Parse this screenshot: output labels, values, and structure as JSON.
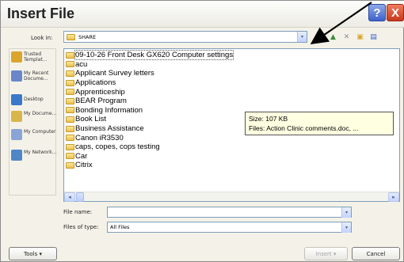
{
  "dialog": {
    "title": "Insert File",
    "help_glyph": "?",
    "close_glyph": "X"
  },
  "look_in": {
    "label": "Look in:",
    "value": "SHARE",
    "dropdown_glyph": "▾"
  },
  "toolbar": [
    {
      "name": "back-icon",
      "glyph": "◀"
    },
    {
      "name": "up-folder-icon",
      "glyph": "▲"
    },
    {
      "name": "delete-icon",
      "glyph": "✕"
    },
    {
      "name": "new-folder-icon",
      "glyph": "▣"
    },
    {
      "name": "views-icon",
      "glyph": "▤"
    }
  ],
  "places": [
    {
      "name": "trusted-templates",
      "label": "Trusted Templat...",
      "color": "#d9a52c"
    },
    {
      "name": "my-recent-documents",
      "label": "My Recent Docume...",
      "color": "#6a86c9"
    },
    {
      "name": "desktop",
      "label": "Desktop",
      "color": "#3a79c9"
    },
    {
      "name": "my-documents",
      "label": "My Docume...",
      "color": "#d8b64b"
    },
    {
      "name": "my-computer",
      "label": "My Computer",
      "color": "#8aa4d6"
    },
    {
      "name": "my-network",
      "label": "My Network...",
      "color": "#4f86c6"
    }
  ],
  "files": [
    "09-10-26 Front Desk GX620 Computer settings",
    "acu",
    "Applicant Survey letters",
    "Applications",
    "Apprenticeship",
    "BEAR Program",
    "Bonding Information",
    "Book List",
    "Business Assistance",
    "Canon iR3530",
    "caps, copes, cops testing",
    "Car",
    "Citrix"
  ],
  "tooltip": {
    "line1": "Size: 107 KB",
    "line2": "Files: Action Clinic comments.doc, ..."
  },
  "scroll": {
    "left_glyph": "◂",
    "right_glyph": "▸"
  },
  "file_name": {
    "label": "File name:",
    "value": "",
    "dropdown_glyph": "▾"
  },
  "file_type": {
    "label": "Files of type:",
    "value": "All Files",
    "dropdown_glyph": "▾"
  },
  "buttons": {
    "tools": "Tools  ▾",
    "insert": "Insert  ▾",
    "cancel": "Cancel"
  }
}
